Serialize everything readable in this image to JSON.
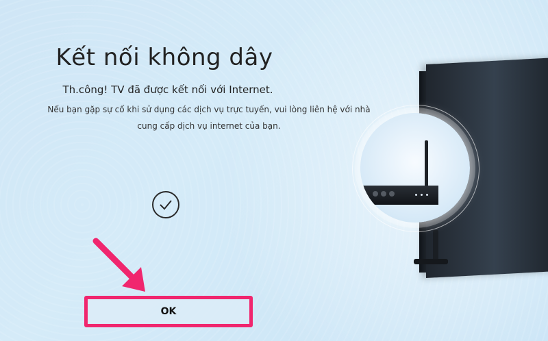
{
  "screen": {
    "title": "Kết nối không dây",
    "status": "Th.công! TV đã được kết nối với Internet.",
    "help_line1": "Nếu bạn gặp sự cố khi sử dụng các dịch vụ trực tuyến, vui lòng liên hệ với nhà",
    "help_line2": "cung cấp dịch vụ internet của bạn."
  },
  "actions": {
    "ok_label": "OK"
  },
  "icons": {
    "success": "checkmark-icon",
    "pointer": "arrow-pointer-icon"
  },
  "colors": {
    "highlight": "#f0266e",
    "text": "#222222",
    "background": "#cfe6f6"
  }
}
